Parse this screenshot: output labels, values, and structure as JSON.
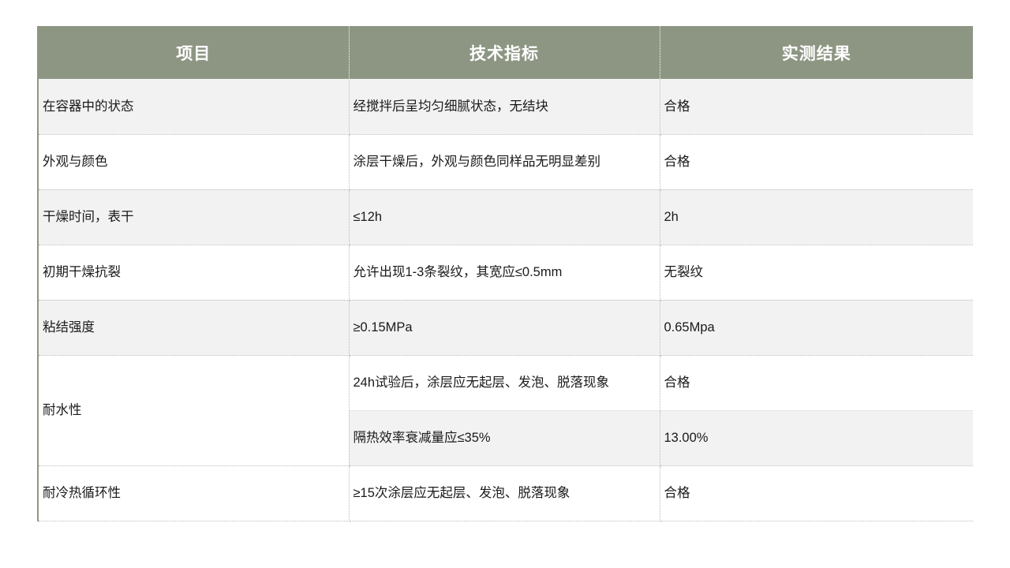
{
  "table": {
    "headers": [
      "项目",
      "技术指标",
      "实测结果"
    ],
    "rows": [
      {
        "item": "在容器中的状态",
        "spec": "经搅拌后呈均匀细腻状态，无结块",
        "result": "合格"
      },
      {
        "item": "外观与颜色",
        "spec": "涂层干燥后，外观与颜色同样品无明显差别",
        "result": "合格"
      },
      {
        "item": "干燥时间，表干",
        "spec": "≤12h",
        "result": "2h"
      },
      {
        "item": "初期干燥抗裂",
        "spec": "允许出现1-3条裂纹，其宽应≤0.5mm",
        "result": "无裂纹"
      },
      {
        "item": "粘结强度",
        "spec": "≥0.15MPa",
        "result": "0.65Mpa"
      },
      {
        "item": "耐水性",
        "spec_a": "24h试验后，涂层应无起层、发泡、脱落现象",
        "result_a": "合格",
        "spec_b": "隔热效率衰减量应≤35%",
        "result_b": "13.00%"
      },
      {
        "item": "耐冷热循环性",
        "spec": "≥15次涂层应无起层、发泡、脱落现象",
        "result": "合格"
      }
    ]
  },
  "colors": {
    "header_background": "#8d9683",
    "header_text": "#ffffff",
    "row_shaded": "#f2f2f2",
    "row_plain": "#ffffff",
    "grid_line": "#b9b9b9",
    "body_text": "#1a1a1a"
  }
}
